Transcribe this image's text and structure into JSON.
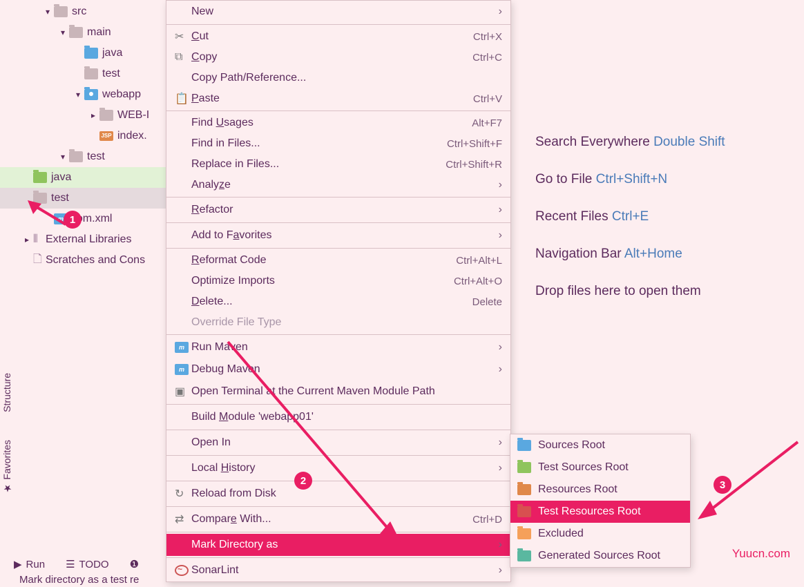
{
  "tree": {
    "src": "src",
    "main": "main",
    "java": "java",
    "test": "test",
    "webapp": "webapp",
    "webinf": "WEB-I",
    "index": "index.",
    "test2": "test",
    "java2": "java",
    "test3": "test",
    "pom": "pom.xml",
    "ext": "External Libraries",
    "scratch": "Scratches and Cons"
  },
  "menu": {
    "new": "New",
    "cut": "Cut",
    "cut_s": "Ctrl+X",
    "copy": "Copy",
    "copy_s": "Ctrl+C",
    "copypath": "Copy Path/Reference...",
    "paste": "Paste",
    "paste_s": "Ctrl+V",
    "findusages": "Find Usages",
    "findusages_s": "Alt+F7",
    "findin": "Find in Files...",
    "findin_s": "Ctrl+Shift+F",
    "replin": "Replace in Files...",
    "replin_s": "Ctrl+Shift+R",
    "analyze": "Analyze",
    "refactor": "Refactor",
    "addfav": "Add to Favorites",
    "reformat": "Reformat Code",
    "reformat_s": "Ctrl+Alt+L",
    "optimize": "Optimize Imports",
    "optimize_s": "Ctrl+Alt+O",
    "delete": "Delete...",
    "delete_s": "Delete",
    "override": "Override File Type",
    "runmaven": "Run Maven",
    "debugmaven": "Debug Maven",
    "openterm": "Open Terminal at the Current Maven Module Path",
    "buildmod": "Build Module 'webapp01'",
    "openin": "Open In",
    "localhist": "Local History",
    "reload": "Reload from Disk",
    "compare": "Compare With...",
    "compare_s": "Ctrl+D",
    "markdir": "Mark Directory as",
    "sonar": "SonarLint"
  },
  "submenu": {
    "src": "Sources Root",
    "testsrc": "Test Sources Root",
    "res": "Resources Root",
    "testres": "Test Resources Root",
    "excl": "Excluded",
    "gen": "Generated Sources Root"
  },
  "hints": {
    "search": "Search Everywhere",
    "search_k": "Double Shift",
    "goto": "Go to File",
    "goto_k": "Ctrl+Shift+N",
    "recent": "Recent Files",
    "recent_k": "Ctrl+E",
    "nav": "Navigation Bar",
    "nav_k": "Alt+Home",
    "drop": "Drop files here to open them"
  },
  "bottom": {
    "run": "Run",
    "todo": "TODO"
  },
  "status": "Mark directory as a test re",
  "side": {
    "struct": "Structure",
    "fav": "Favorites"
  },
  "badges": {
    "b1": "1",
    "b2": "2",
    "b3": "3"
  },
  "watermark": "Yuucn.com"
}
